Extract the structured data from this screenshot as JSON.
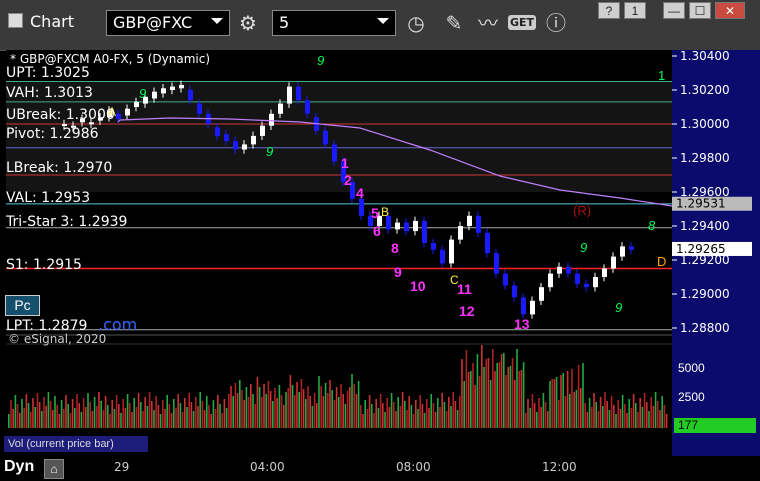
{
  "toolbar": {
    "title": "Chart",
    "symbol": "GBP@FXC",
    "interval": "5",
    "gear_icon": "gear-icon",
    "clock_icon": "clock-icon",
    "pencil_icon": "pencil-icon",
    "studies_icon": "studies-icon",
    "get_label": "GET",
    "info_icon": "info-icon"
  },
  "window_buttons": {
    "help": "?",
    "toggle": "1",
    "minimize": "—",
    "maximize": "☐",
    "close": "✕"
  },
  "chart_header": "* GBP@FXCM A0-FX, 5 (Dynamic)",
  "copyright": "© eSignal, 2020",
  "levels": [
    {
      "label": "UPT: 1.3025",
      "value": 1.3025
    },
    {
      "label": "VAH: 1.3013",
      "value": 1.3013
    },
    {
      "label": "UBreak: 1.3000",
      "value": 1.3
    },
    {
      "label": "Pivot: 1.2986",
      "value": 1.2986
    },
    {
      "label": "LBreak: 1.2970",
      "value": 1.297
    },
    {
      "label": "VAL: 1.2953",
      "value": 1.2953
    },
    {
      "label": "Tri-Star 3: 1.2939",
      "value": 1.2939
    },
    {
      "label": "S1: 1.2915",
      "value": 1.2915
    },
    {
      "label": "LPT: 1.2879",
      "value": 1.2879
    }
  ],
  "price_axis": [
    "1.30400",
    "1.30200",
    "1.30000",
    "1.29800",
    "1.29600",
    "1.29400",
    "1.29200",
    "1.29000",
    "1.28800"
  ],
  "price_tags": [
    {
      "text": "1.29531",
      "value": 1.29531,
      "color": "#bbbbbb"
    },
    {
      "text": "1.29265",
      "value": 1.29265,
      "color": "#ffffff"
    }
  ],
  "volume_axis": [
    "5000",
    "2500"
  ],
  "volume_current": "177",
  "volume_label": "Vol (current price bar)",
  "time_axis": [
    "29",
    "04:00",
    "08:00",
    "12:00"
  ],
  "pc_button": "Pc",
  "pc_link": ".com",
  "dyn_label": "Dyn",
  "colors": {
    "up": "#ffffff",
    "down": "#1a1aff",
    "ma": "#c080ff",
    "buy_count": "#00ff55",
    "sell_count": "#ff33ff",
    "tag_green": "#22cc22"
  }
}
